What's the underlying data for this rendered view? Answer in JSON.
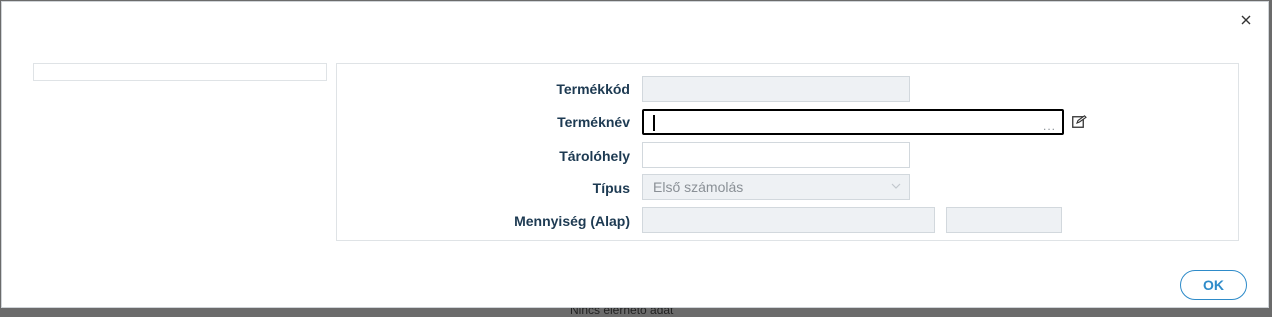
{
  "background": {
    "partial_text": "Nincs elérhető adat"
  },
  "dialog": {
    "close_symbol": "×",
    "ok_label": "OK"
  },
  "form": {
    "fields": [
      {
        "label": "Termékkód",
        "value": "",
        "state": "disabled"
      },
      {
        "label": "Terméknév",
        "value": "",
        "state": "focused",
        "suffix": "..."
      },
      {
        "label": "Tárolóhely",
        "value": "",
        "state": "enabled"
      },
      {
        "label": "Típus",
        "value": "Első számolás",
        "state": "disabled"
      },
      {
        "label": "Mennyiség (Alap)",
        "value": "",
        "value2": "",
        "state": "disabled"
      }
    ]
  },
  "colors": {
    "accent": "#2e8bc9",
    "label": "#1d3a52",
    "disabled_bg": "#eef1f4"
  },
  "icons": [
    "close-icon",
    "edit-icon",
    "chevron-down-icon",
    "ellipsis-icon"
  ]
}
